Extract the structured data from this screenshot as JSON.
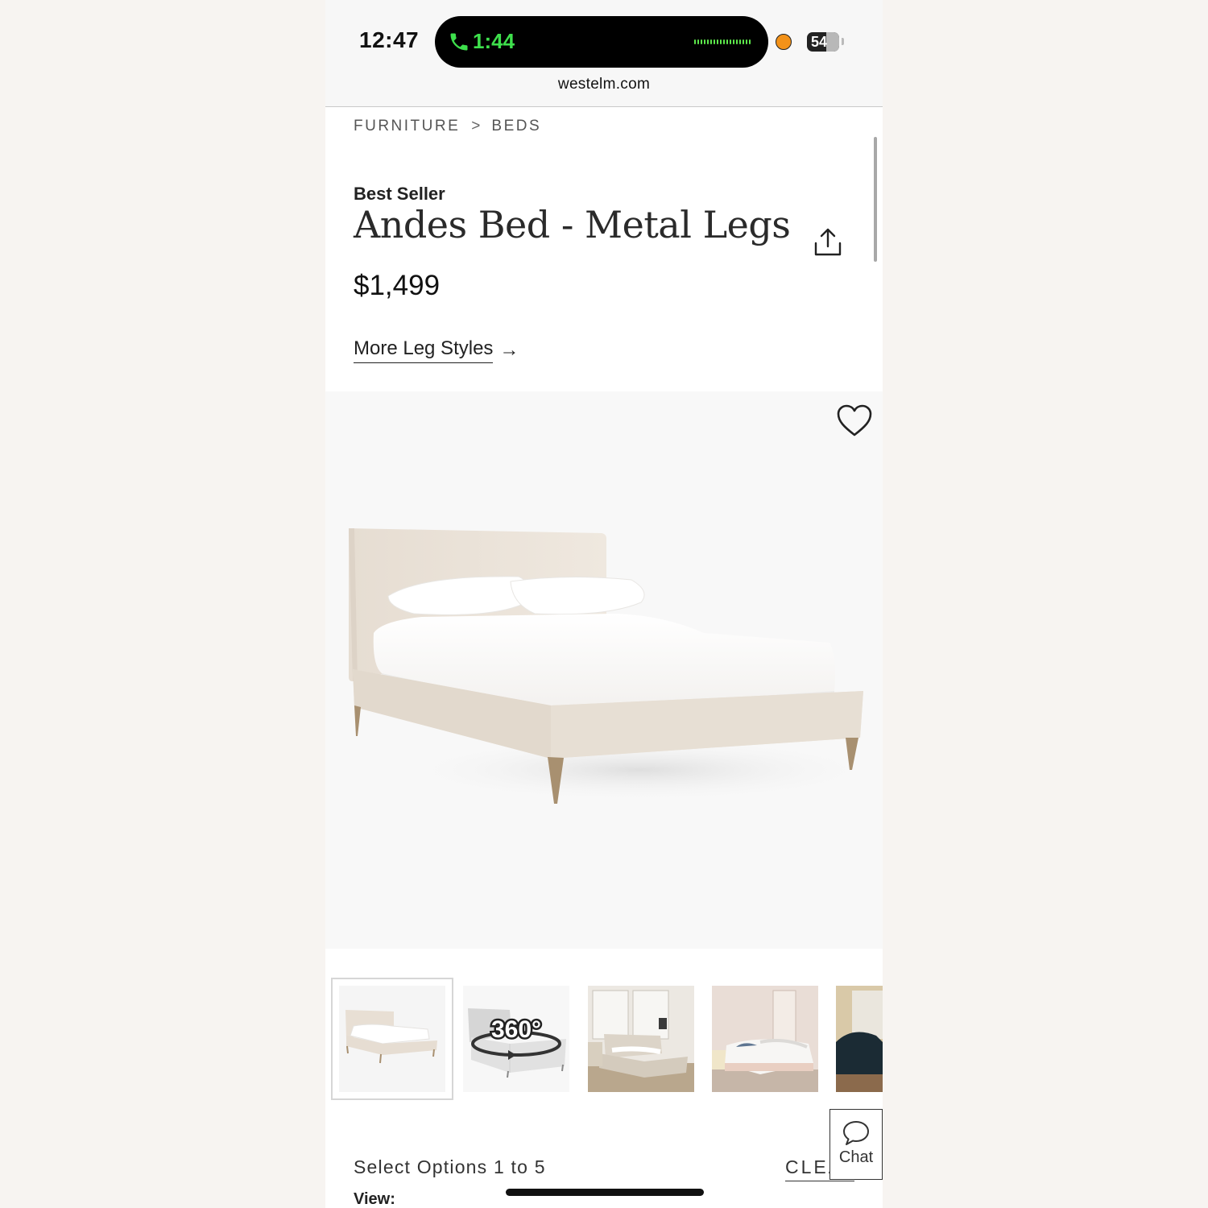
{
  "status_bar": {
    "time": "12:47",
    "call_timer": "1:44",
    "battery": "54",
    "url": "westelm.com"
  },
  "breadcrumb": {
    "items": [
      "FURNITURE",
      "BEDS"
    ],
    "separator": ">"
  },
  "product": {
    "badge": "Best Seller",
    "title": "Andes Bed - Metal Legs",
    "price": "$1,499",
    "more_styles_link": "More Leg Styles",
    "arrow": "→"
  },
  "thumbnails": {
    "badge_360": "360°",
    "selected_index": 0,
    "count_visible": 5
  },
  "options": {
    "select_options": "Select Options 1 to 5",
    "clear": "CLEAR",
    "view_label": "View:"
  },
  "chat": {
    "label": "Chat"
  },
  "icons": {
    "call": "phone-icon",
    "share": "share-icon",
    "favorite": "heart-icon",
    "chat": "speech-bubble-icon"
  },
  "colors": {
    "call_green": "#3ee04c",
    "mic_indicator": "#f39219",
    "upholstery": "#ebe3d9",
    "leg_brass": "#a89070"
  }
}
